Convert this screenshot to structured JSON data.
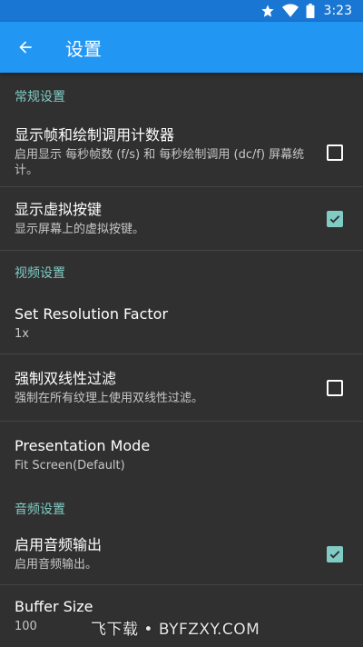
{
  "status_bar": {
    "time": "3:23"
  },
  "app_bar": {
    "title": "设置"
  },
  "sections": {
    "general": "常规设置",
    "video": "视频设置",
    "audio": "音频设置"
  },
  "prefs": {
    "fps_counter": {
      "title": "显示帧和绘制调用计数器",
      "summary": "启用显示 每秒帧数 (f/s) 和 每秒绘制调用 (dc/f) 屏幕统计。",
      "checked": false
    },
    "virtual_buttons": {
      "title": "显示虚拟按键",
      "summary": "显示屏幕上的虚拟按键。",
      "checked": true
    },
    "resolution_factor": {
      "title": "Set Resolution Factor",
      "summary": "1x"
    },
    "bilinear_filter": {
      "title": "强制双线性过滤",
      "summary": "强制在所有纹理上使用双线性过滤。",
      "checked": false
    },
    "presentation_mode": {
      "title": "Presentation Mode",
      "summary": "Fit Screen(Default)"
    },
    "audio_output": {
      "title": "启用音频输出",
      "summary": "启用音频输出。",
      "checked": true
    },
    "buffer_size": {
      "title": "Buffer Size",
      "summary": "100"
    }
  },
  "watermark": "飞下载 • BYFZXY.COM",
  "colors": {
    "status_bar": "#1976d2",
    "app_bar": "#2196f3",
    "background": "#303030",
    "accent": "#80cbc4"
  }
}
